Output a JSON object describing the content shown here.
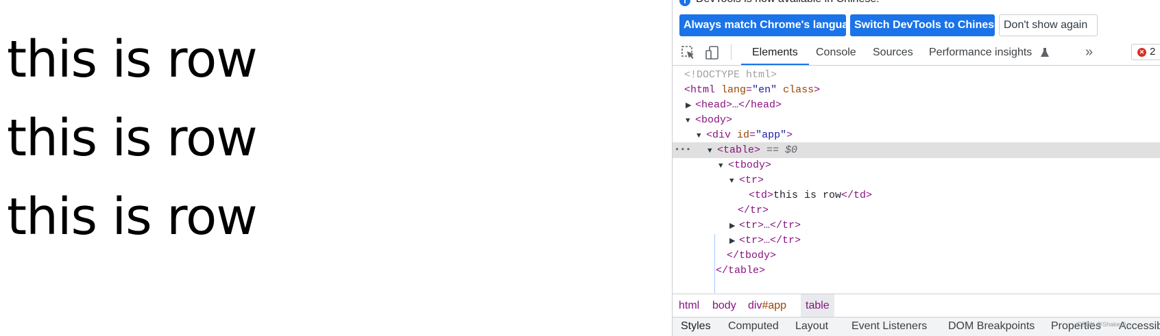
{
  "page": {
    "rows": [
      "this is row",
      "this is row",
      "this is row"
    ]
  },
  "devtools": {
    "notice": {
      "text": "DevTools is now available in Chinese!",
      "buttons": [
        "Always match Chrome's language",
        "Switch DevTools to Chinese",
        "Don't show again"
      ]
    },
    "tabs": [
      "Elements",
      "Console",
      "Sources",
      "Performance insights"
    ],
    "more_tabs": "»",
    "error_count": "2",
    "tree": {
      "doctype": "<!DOCTYPE html>",
      "html_open_tag": "<html",
      "html_attr1_name": "lang",
      "html_attr1_value": "\"en\"",
      "html_attr2_name": "class",
      "head_collapsed": "<head>…</head>",
      "body_open": "<body>",
      "div_open_tag": "<div",
      "div_attr_name": "id",
      "div_attr_value": "\"app\"",
      "table_open": "<table>",
      "table_marker": "== $0",
      "tbody_open": "<tbody>",
      "tr_open": "<tr>",
      "td_open": "<td>",
      "td_text": "this is row",
      "td_close": "</td>",
      "tr_close": "</tr>",
      "tr_collapsed": "<tr>…</tr>",
      "tbody_close": "</tbody>",
      "table_close": "</table>"
    },
    "breadcrumbs": [
      {
        "name": "html",
        "id": ""
      },
      {
        "name": "body",
        "id": ""
      },
      {
        "name": "div",
        "id": "#app"
      },
      {
        "name": "table",
        "id": ""
      }
    ],
    "bottom_tabs": [
      "Styles",
      "Computed",
      "Layout",
      "Event Listeners",
      "DOM Breakpoints",
      "Properties",
      "Accessibi"
    ],
    "watermark": "CSDN @Shake@..."
  },
  "colors": {
    "accent": "#1a73e8",
    "tag": "#881280",
    "attr_name": "#994500",
    "attr_value": "#1a1aa6",
    "error": "#d93025"
  }
}
